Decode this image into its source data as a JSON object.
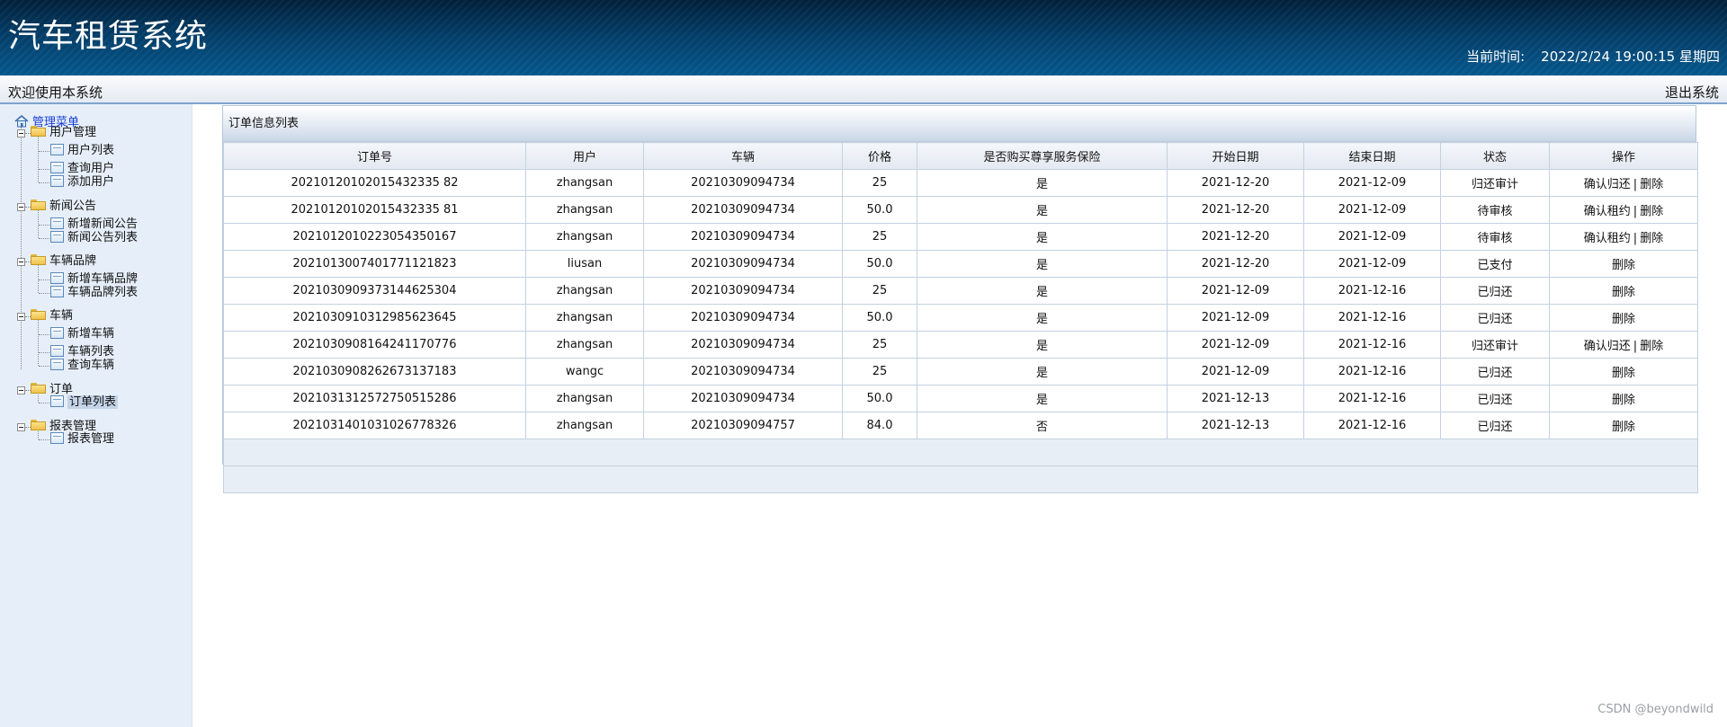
{
  "header": {
    "app_title": "汽车租赁系统",
    "clock_label": "当前时间:",
    "clock_value": "2022/2/24 19:00:15 星期四"
  },
  "welcome_bar": {
    "welcome_text": "欢迎使用本系统",
    "logout_label": "退出系统"
  },
  "sidebar": {
    "root_label": "管理菜单",
    "groups": [
      {
        "label": "用户管理",
        "items": [
          "用户列表",
          "查询用户",
          "添加用户"
        ]
      },
      {
        "label": "新闻公告",
        "items": [
          "新增新闻公告",
          "新闻公告列表"
        ]
      },
      {
        "label": "车辆品牌",
        "items": [
          "新增车辆品牌",
          "车辆品牌列表"
        ]
      },
      {
        "label": "车辆",
        "items": [
          "新增车辆",
          "车辆列表",
          "查询车辆"
        ]
      },
      {
        "label": "订单",
        "items": [
          "订单列表"
        ]
      },
      {
        "label": "报表管理",
        "items": [
          "报表管理"
        ]
      }
    ],
    "selected_item": "订单列表"
  },
  "panel": {
    "title": "订单信息列表",
    "columns": [
      "订单号",
      "用户",
      "车辆",
      "价格",
      "是否购买尊享服务保险",
      "开始日期",
      "结束日期",
      "状态",
      "操作"
    ],
    "rows": [
      {
        "order_no": "20210120102015432335 82",
        "user": "zhangsan",
        "car": "20210309094734",
        "price": "25",
        "insurance": "是",
        "start": "2021-12-20",
        "end": "2021-12-09",
        "status": "归还审计",
        "actions": [
          "确认归还",
          "删除"
        ]
      },
      {
        "order_no": "20210120102015432335 81",
        "user": "zhangsan",
        "car": "20210309094734",
        "price": "50.0",
        "insurance": "是",
        "start": "2021-12-20",
        "end": "2021-12-09",
        "status": "待审核",
        "actions": [
          "确认租约",
          "删除"
        ]
      },
      {
        "order_no": "2021012010223054350167",
        "user": "zhangsan",
        "car": "20210309094734",
        "price": "25",
        "insurance": "是",
        "start": "2021-12-20",
        "end": "2021-12-09",
        "status": "待审核",
        "actions": [
          "确认租约",
          "删除"
        ]
      },
      {
        "order_no": "2021013007401771121823",
        "user": "liusan",
        "car": "20210309094734",
        "price": "50.0",
        "insurance": "是",
        "start": "2021-12-20",
        "end": "2021-12-09",
        "status": "已支付",
        "actions": [
          "删除"
        ]
      },
      {
        "order_no": "2021030909373144625304",
        "user": "zhangsan",
        "car": "20210309094734",
        "price": "25",
        "insurance": "是",
        "start": "2021-12-09",
        "end": "2021-12-16",
        "status": "已归还",
        "actions": [
          "删除"
        ]
      },
      {
        "order_no": "2021030910312985623645",
        "user": "zhangsan",
        "car": "20210309094734",
        "price": "50.0",
        "insurance": "是",
        "start": "2021-12-09",
        "end": "2021-12-16",
        "status": "已归还",
        "actions": [
          "删除"
        ]
      },
      {
        "order_no": "2021030908164241170776",
        "user": "zhangsan",
        "car": "20210309094734",
        "price": "25",
        "insurance": "是",
        "start": "2021-12-09",
        "end": "2021-12-16",
        "status": "归还审计",
        "actions": [
          "确认归还",
          "删除"
        ]
      },
      {
        "order_no": "2021030908262673137183",
        "user": "wangc",
        "car": "20210309094734",
        "price": "25",
        "insurance": "是",
        "start": "2021-12-09",
        "end": "2021-12-16",
        "status": "已归还",
        "actions": [
          "删除"
        ]
      },
      {
        "order_no": "2021031312572750515286",
        "user": "zhangsan",
        "car": "20210309094734",
        "price": "50.0",
        "insurance": "是",
        "start": "2021-12-13",
        "end": "2021-12-16",
        "status": "已归还",
        "actions": [
          "删除"
        ]
      },
      {
        "order_no": "2021031401031026778326",
        "user": "zhangsan",
        "car": "20210309094757",
        "price": "84.0",
        "insurance": "否",
        "start": "2021-12-13",
        "end": "2021-12-16",
        "status": "已归还",
        "actions": [
          "删除"
        ]
      }
    ],
    "action_separator": "|"
  },
  "watermark": "CSDN @beyondwild"
}
